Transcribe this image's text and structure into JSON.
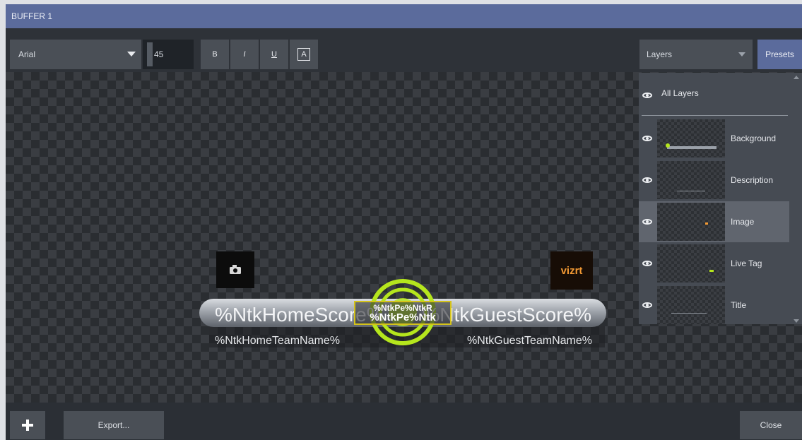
{
  "window": {
    "title": "BUFFER 1"
  },
  "toolbar": {
    "font_family": "Arial",
    "font_size": "45",
    "bold_label": "B",
    "italic_label": "I",
    "underline_label": "U",
    "shadow_label": "A",
    "layers_dropdown": "Layers",
    "presets_label": "Presets"
  },
  "layers_panel": {
    "all_layers_label": "All Layers",
    "items": [
      {
        "label": "Background",
        "selected": false
      },
      {
        "label": "Description",
        "selected": false
      },
      {
        "label": "Image",
        "selected": true
      },
      {
        "label": "Live Tag",
        "selected": false
      },
      {
        "label": "Title",
        "selected": false
      }
    ]
  },
  "canvas": {
    "home_score": "%NtkHomeScore%",
    "guest_score": "%NtkGuestScore%",
    "center_text_top": "%NtkPe%NtkR",
    "center_text": "%NtkPe%Ntk",
    "home_team": "%NtkHomeTeamName%",
    "guest_team": "%NtkGuestTeamName%",
    "logo_text": "vizrt"
  },
  "colors": {
    "titlebar": "#5b6b9c",
    "accent_green": "#b5e61d",
    "selection_yellow": "#d4c21a",
    "logo_orange": "#f39a34"
  },
  "bottom": {
    "add_icon": "plus-icon",
    "export_label": "Export...",
    "close_label": "Close"
  }
}
